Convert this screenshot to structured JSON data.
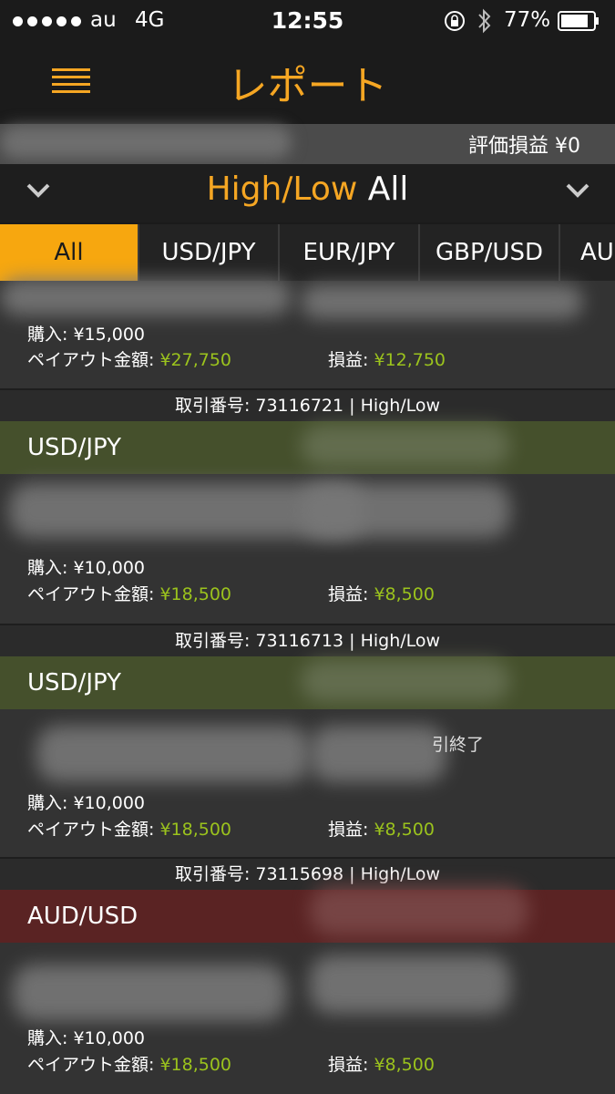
{
  "status_bar": {
    "carrier": "au",
    "network": "4G",
    "time": "12:55",
    "battery": "77%",
    "icons": [
      "signal-dots-icon",
      "rotation-lock-icon",
      "bluetooth-icon",
      "battery-icon"
    ]
  },
  "nav": {
    "title": "レポート",
    "menu_icon": "hamburger-menu-icon"
  },
  "summary": {
    "valuation_label": "評価損益 ¥0"
  },
  "selector": {
    "type_label": "High/Low",
    "filter_label": "All",
    "left_icon": "chevron-down-icon",
    "right_icon": "chevron-down-icon"
  },
  "tabs": [
    {
      "label": "All",
      "active": true
    },
    {
      "label": "USD/JPY",
      "active": false
    },
    {
      "label": "EUR/JPY",
      "active": false
    },
    {
      "label": "GBP/USD",
      "active": false
    },
    {
      "label": "AU",
      "active": false
    }
  ],
  "trades": [
    {
      "purchase": "購入: ¥15,000",
      "payout_label": "ペイアウト金額:",
      "payout_value": "¥27,750",
      "pl_label": "損益:",
      "pl_value": "¥12,750"
    },
    {
      "header": "取引番号: 73116721 | High/Low",
      "pair": "USD/JPY",
      "result": "win",
      "purchase": "購入: ¥10,000",
      "payout_label": "ペイアウト金額:",
      "payout_value": "¥18,500",
      "pl_label": "損益:",
      "pl_value": "¥8,500"
    },
    {
      "header": "取引番号: 73116713 | High/Low",
      "pair": "USD/JPY",
      "result": "win",
      "status_fragment": "引終了",
      "purchase": "購入: ¥10,000",
      "payout_label": "ペイアウト金額:",
      "payout_value": "¥18,500",
      "pl_label": "損益:",
      "pl_value": "¥8,500"
    },
    {
      "header": "取引番号: 73115698 | High/Low",
      "pair": "AUD/USD",
      "result": "loss",
      "purchase": "購入: ¥10,000",
      "payout_label": "ペイアウト金額:",
      "payout_value": "¥18,500",
      "pl_label": "損益:",
      "pl_value": "¥8,500"
    }
  ],
  "colors": {
    "accent": "#f5a623",
    "profit_green": "#9bc31d",
    "win_bar": "#45502c",
    "loss_bar": "#5a2323",
    "background": "#2e2e2e"
  }
}
